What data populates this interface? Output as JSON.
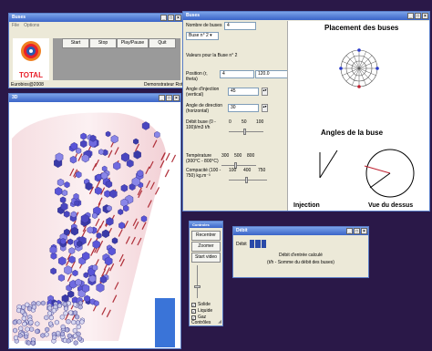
{
  "main_window": {
    "title": "Buses",
    "menu": [
      "File",
      "Options"
    ],
    "buttons": [
      "Start",
      "Stop",
      "Play/Pause",
      "Quit"
    ],
    "logo_text": "TOTAL",
    "copyright": "Eurobios@2008",
    "status_text": "Demonstrateur Rot"
  },
  "view3d": {
    "title": "3D"
  },
  "buses": {
    "title": "Buses",
    "count_label": "Nombre de buses",
    "count_value": "4",
    "selected_bus": "Buse n° 2",
    "values_label": "Valeurs pour la Buse n° 2",
    "position_label": "Position (r, theta)",
    "position_r": "4",
    "position_theta": "120.0",
    "angle_inj_label": "Angle d'injection (vertical)",
    "angle_inj_value": "45",
    "angle_dir_label": "Angle de direction (horizontal)",
    "angle_dir_value": "30",
    "debit_label": "Débit buse (0 - 100)l/m3 t/h",
    "debit_ticks": [
      "0",
      "50",
      "100"
    ],
    "temp_label": "Température (300°C - 800°C)",
    "temp_ticks": [
      "300",
      "500",
      "800"
    ],
    "compacite_label": "Compacité (100 - 750) kg.m⁻³",
    "compacite_ticks": [
      "100",
      "400",
      "750"
    ],
    "placement_heading": "Placement des buses",
    "angles_heading": "Angles de  la buse",
    "injection_label": "Injection",
    "dessus_label": "Vue du dessus"
  },
  "controls": {
    "title": "Controles",
    "buttons": [
      "Recentrer",
      "Zoomer",
      "Start video"
    ],
    "checkboxes": [
      {
        "label": "Solide",
        "checked": true
      },
      {
        "label": "Liquide",
        "checked": true
      },
      {
        "label": "Gaz",
        "checked": true
      }
    ],
    "footer": "Contrôles"
  },
  "debit_window": {
    "title": "Débit",
    "debit_label": "Débit",
    "line1": "Débit d'entrée calculé",
    "line2": "(t/h - Somme du débit des buses)"
  },
  "colors": {
    "accent": "#3a64c8",
    "desktop": "#2a1848",
    "window": "#ece9d8",
    "particle": "#5a55d8",
    "arrow": "#b0303a",
    "total_red": "#e8202a",
    "total_orange": "#f08020"
  }
}
